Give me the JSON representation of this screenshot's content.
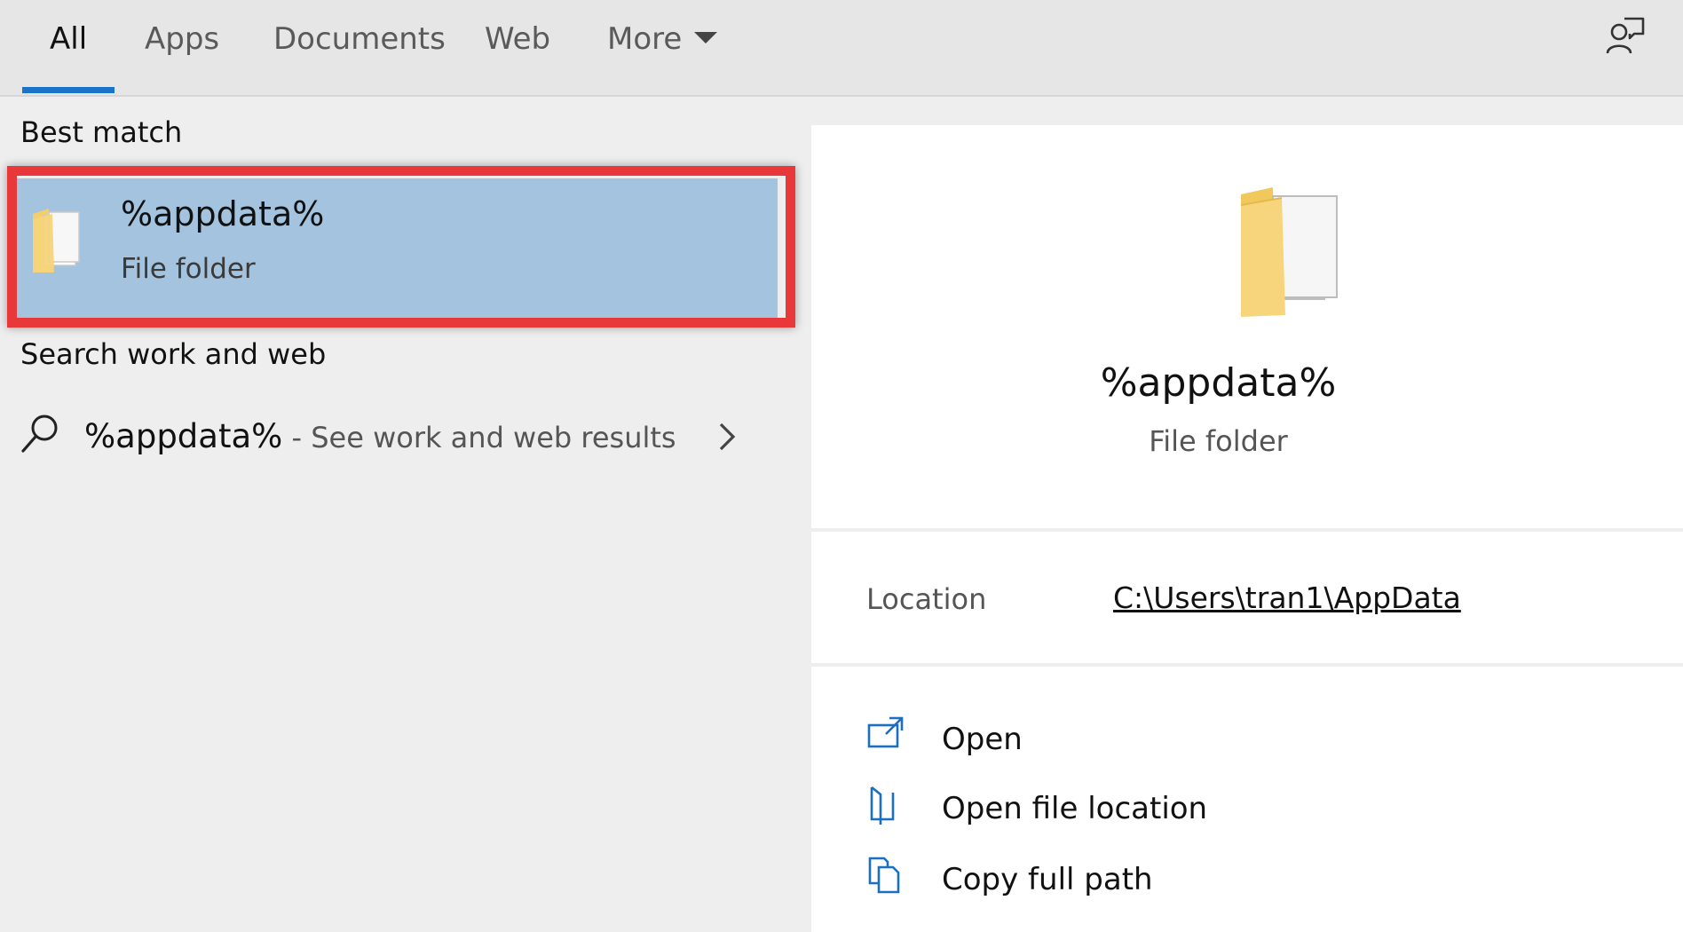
{
  "tabs": [
    {
      "label": "All",
      "active": true
    },
    {
      "label": "Apps",
      "active": false
    },
    {
      "label": "Documents",
      "active": false
    },
    {
      "label": "Web",
      "active": false
    },
    {
      "label": "More",
      "active": false
    }
  ],
  "topbar": {
    "feedback_icon": "feedback-person-icon",
    "accent_color": "#1a73c8"
  },
  "left": {
    "best_match_heading": "Best match",
    "best_match": {
      "title": "%appdata%",
      "subtitle": "File folder",
      "icon": "folder-icon",
      "selected_color": "#a4c3de",
      "highlight_color": "#e8383a"
    },
    "web_heading": "Search work and web",
    "web_result": {
      "query": "%appdata%",
      "suffix": " - See work and web results",
      "icon": "search-icon"
    }
  },
  "preview": {
    "icon": "folder-icon",
    "title": "%appdata%",
    "subtitle": "File folder",
    "location_label": "Location",
    "location_value": "C:\\Users\\tran1\\AppData",
    "actions": [
      {
        "label": "Open",
        "icon": "open-icon"
      },
      {
        "label": "Open file location",
        "icon": "file-location-icon"
      },
      {
        "label": "Copy full path",
        "icon": "copy-path-icon"
      }
    ]
  }
}
